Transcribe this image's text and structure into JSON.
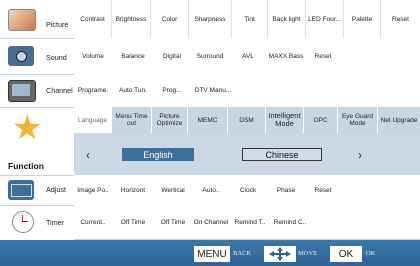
{
  "sidebar": {
    "items": [
      {
        "label": "Picture",
        "icon": "picture-icon"
      },
      {
        "label": "Sound",
        "icon": "speaker-icon"
      },
      {
        "label": "Channel",
        "icon": "channel-icon"
      },
      {
        "label": "Function",
        "icon": "star-wand-icon"
      },
      {
        "label": "Adjust",
        "icon": "adjust-icon"
      },
      {
        "label": "Timer",
        "icon": "clock-icon"
      }
    ]
  },
  "rows": {
    "picture": [
      "Contrast",
      "Brightness",
      "Color",
      "Sharpness",
      "Tint",
      "Back light",
      "LED Four...",
      "Palette",
      "Reset"
    ],
    "sound": [
      "Volume",
      "Balance",
      "Digital",
      "Surround",
      "AVL",
      "MAXX Bass",
      "Reset"
    ],
    "channel": [
      "Programe.",
      "Auto Tun.",
      "Prog...",
      "DTV Manu..."
    ],
    "function_head": [
      "Language",
      "Menu Time out",
      "Picture Optimize",
      "MEMC",
      "DSM",
      "Intelligent Mode",
      "OPC",
      "Eye Guard Mode",
      "Net Upgrade"
    ],
    "adjust": [
      "Image Po..",
      "Horizont",
      "Wertical",
      "Auto..",
      "Clock",
      "Phase",
      "Reset"
    ],
    "timer": [
      "Current..",
      "Off Time",
      "Off Time",
      "On Channel",
      "Remind T..",
      "Remind C.."
    ]
  },
  "language": {
    "selected": "English",
    "other": "Chinese",
    "left_arrow": "‹",
    "right_arrow": "›"
  },
  "bottom": {
    "menu_key": "MENU",
    "menu_text": "BACK",
    "move_text": "MOVE",
    "ok_key": "OK",
    "ok_text": "OK"
  },
  "colors": {
    "header_blue": "#c8d6e4",
    "selected_blue": "#3d6f98",
    "bar_blue": "#2e6496"
  }
}
